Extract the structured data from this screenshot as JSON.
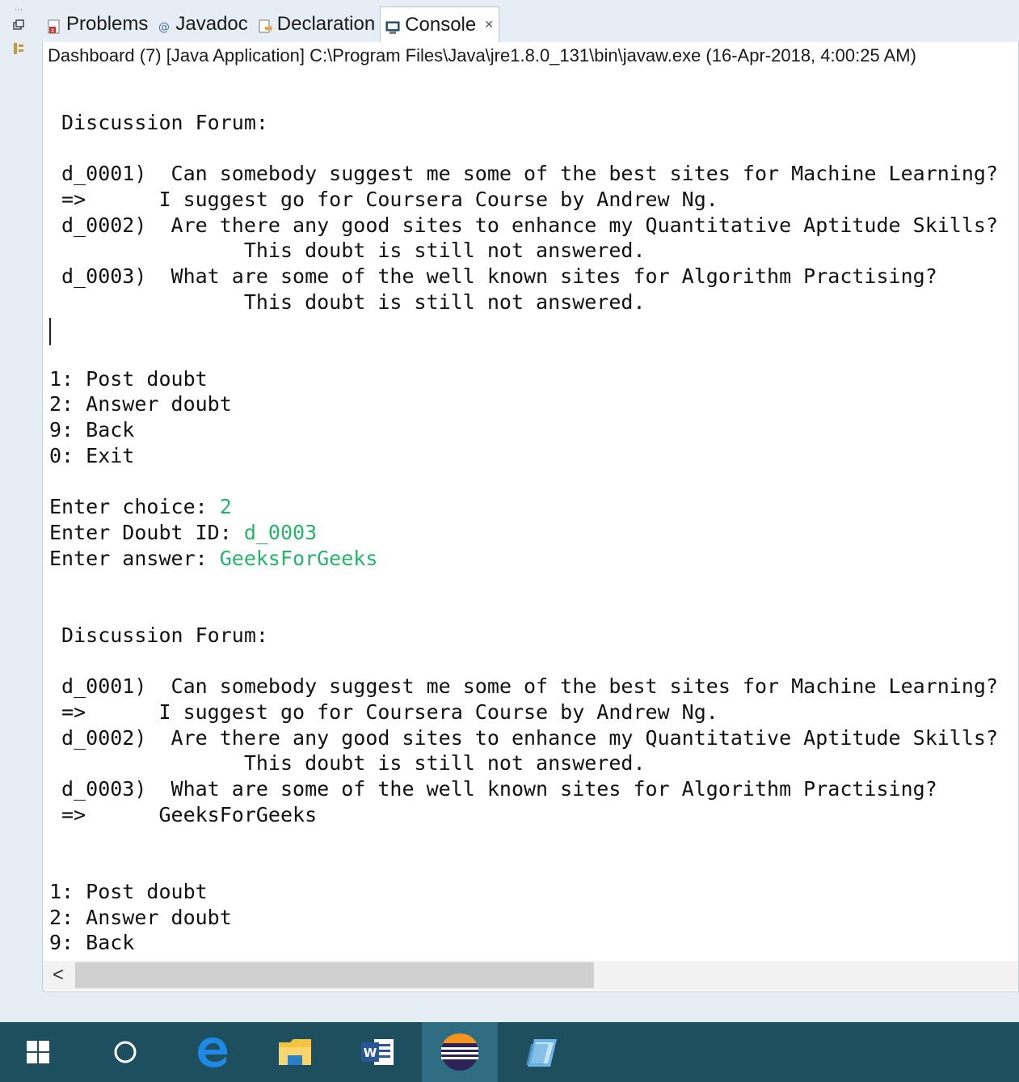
{
  "tabs": [
    {
      "label": "Problems",
      "icon": "problems-icon"
    },
    {
      "label": "Javadoc",
      "icon": "javadoc-icon"
    },
    {
      "label": "Declaration",
      "icon": "declaration-icon"
    },
    {
      "label": "Console",
      "icon": "console-icon",
      "active": true,
      "close": "✕"
    }
  ],
  "launch_title": "Dashboard (7) [Java Application] C:\\Program Files\\Java\\jre1.8.0_131\\bin\\javaw.exe (16-Apr-2018, 4:00:25 AM)",
  "console": {
    "block1": "\n Discussion Forum:\n\n d_0001)  Can somebody suggest me some of the best sites for Machine Learning?\n =>      I suggest go for Coursera Course by Andrew Ng.\n d_0002)  Are there any good sites to enhance my Quantitative Aptitude Skills?\n                This doubt is still not answered.\n d_0003)  What are some of the well known sites for Algorithm Practising?\n                This doubt is still not answered.\n\n\n1: Post doubt\n2: Answer doubt\n9: Back\n0: Exit\n\n",
    "prompt_choice": "Enter choice: ",
    "input_choice": "2",
    "prompt_id": "Enter Doubt ID: ",
    "input_id": "d_0003",
    "prompt_answer": "Enter answer: ",
    "input_answer": "GeeksForGeeks",
    "block2": "\n\n Discussion Forum:\n\n d_0001)  Can somebody suggest me some of the best sites for Machine Learning?\n =>      I suggest go for Coursera Course by Andrew Ng.\n d_0002)  Are there any good sites to enhance my Quantitative Aptitude Skills?\n                This doubt is still not answered.\n d_0003)  What are some of the well known sites for Algorithm Practising?\n =>      GeeksForGeeks\n\n\n1: Post doubt\n2: Answer doubt\n9: Back"
  },
  "scroll_left": "<",
  "colors": {
    "user_input": "#26b36b",
    "taskbar": "#1e4f5f",
    "active_taskbar": "#2f6e82"
  },
  "taskbar_apps": [
    "windows-start-icon",
    "cortana-circle-icon",
    "edge-browser-icon",
    "file-explorer-icon",
    "word-icon",
    "eclipse-icon",
    "notepad-icon"
  ]
}
